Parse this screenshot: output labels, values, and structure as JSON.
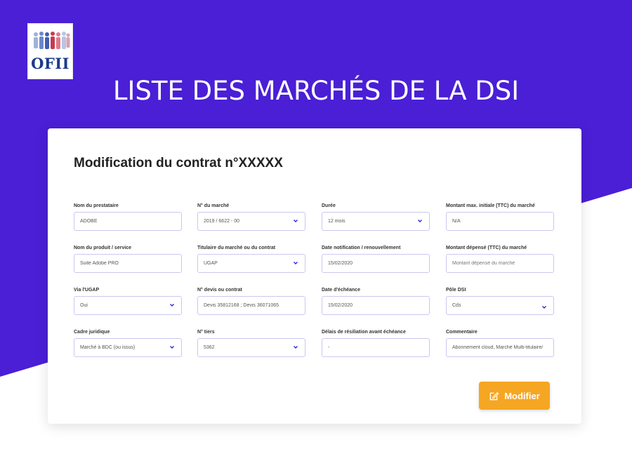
{
  "logo": {
    "text": "OFII",
    "icon": "people-figures-icon"
  },
  "header": {
    "title": "LISTE DES MARCHÉS DE LA DSI"
  },
  "form": {
    "title": "Modification du contrat n°XXXXX",
    "fields": {
      "prestataire": {
        "label": "Nom du prestataire",
        "value": "ADOBE"
      },
      "marche": {
        "label": "N° du marché",
        "value": "2019 / 6622 - 00"
      },
      "duree": {
        "label": "Durée",
        "value": "12 mois"
      },
      "montant_max": {
        "label": "Montant max. initiale (TTC) du marché",
        "value": "N/A"
      },
      "produit": {
        "label": "Nom du produit / service",
        "value": "Suite Adobe PRO"
      },
      "titulaire": {
        "label": "Titulaire du marché ou du contrat",
        "value": "UGAP"
      },
      "date_notification": {
        "label": "Date notification / renouvellement",
        "value": "15/02/2020"
      },
      "montant_depense": {
        "label": "Montant dépensé (TTC) du marché",
        "placeholder": "Montant dépensé du marché"
      },
      "via_ugap": {
        "label": "Via l'UGAP",
        "value": "Oui"
      },
      "devis": {
        "label": "N° devis ou contrat",
        "value": "Devis 35812168 ; Devis 36071065"
      },
      "date_echeance": {
        "label": "Date d'échéance",
        "value": "15/02/2020"
      },
      "pole": {
        "label": "Pôle DSI",
        "value": "Cds"
      },
      "cadre": {
        "label": "Cadre juridique",
        "value": "Marché à BDC (ou issus)"
      },
      "tiers": {
        "label": "N° tiers",
        "value": "5362"
      },
      "delais": {
        "label": "Délais de résiliation avant échéance",
        "value": "-"
      },
      "commentaire": {
        "label": "Commentaire",
        "value": "Abonnement cloud, Marché Multi-titulaire/ Ti..."
      }
    },
    "submit_label": "Modifier"
  },
  "colors": {
    "header_bg": "#4a1fd6",
    "button_bg": "#f5a623",
    "field_border": "#c9c9f2",
    "chevron": "#3a2bd0"
  }
}
